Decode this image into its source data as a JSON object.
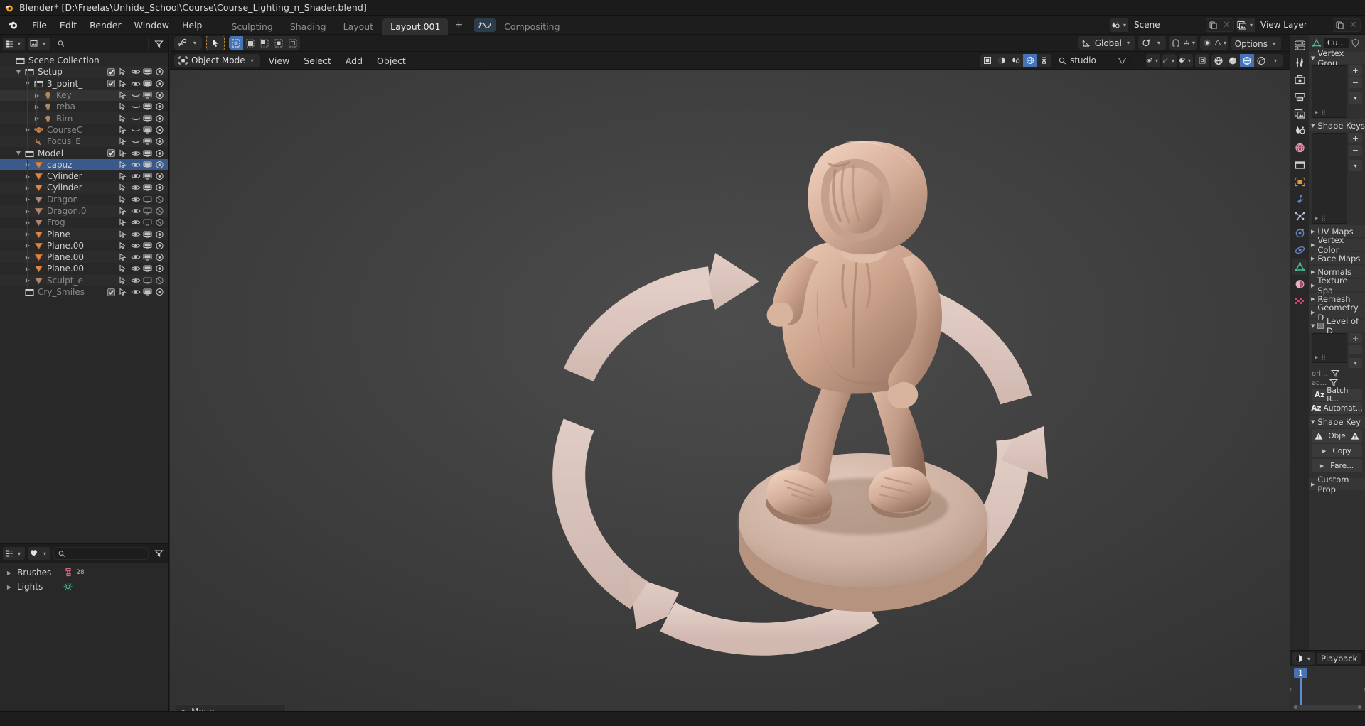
{
  "window": {
    "title": "Blender* [D:\\Freelas\\Unhide_School\\Course\\Course_Lighting_n_Shader.blend]"
  },
  "topbar": {
    "menus": [
      "File",
      "Edit",
      "Render",
      "Window",
      "Help"
    ],
    "workspaces": [
      {
        "label": "Sculpting",
        "active": false
      },
      {
        "label": "Shading",
        "active": false
      },
      {
        "label": "Layout",
        "active": false
      },
      {
        "label": "Layout.001",
        "active": true
      },
      {
        "label": "Compositing",
        "active": false
      }
    ],
    "add_workspace": "+",
    "scene": {
      "label": "Scene",
      "icon": "scene-icon"
    },
    "view_layer": {
      "label": "View Layer",
      "icon": "view-layer-icon"
    }
  },
  "outliner": {
    "header": {
      "display_mode": "view-layer-icon",
      "filter_icon": "filter-icon",
      "search_placeholder": "",
      "search_value": ""
    },
    "rows": [
      {
        "label": "Scene Collection",
        "icon": "collection-icon",
        "depth": 0,
        "disclosure": "",
        "dim": false,
        "checkbox": false,
        "controls": [],
        "selected": false
      },
      {
        "label": "Setup",
        "icon": "collection-icon",
        "depth": 1,
        "disclosure": "down",
        "dim": false,
        "checkbox": true,
        "controls": [
          "cursor",
          "eye",
          "screen",
          "camera"
        ],
        "selected": false
      },
      {
        "label": "3_point_",
        "icon": "collection-icon",
        "depth": 2,
        "disclosure": "down",
        "dim": false,
        "checkbox": true,
        "controls": [
          "cursor",
          "eye",
          "screen",
          "camera"
        ],
        "selected": false
      },
      {
        "label": "Key",
        "icon": "light-icon",
        "depth": 3,
        "disclosure": "right",
        "dim": true,
        "checkbox": false,
        "controls": [
          "cursor",
          "eye-closed",
          "screen",
          "camera"
        ],
        "selected": false,
        "highlight": true
      },
      {
        "label": "reba",
        "icon": "light-icon",
        "depth": 3,
        "disclosure": "right",
        "dim": true,
        "checkbox": false,
        "controls": [
          "cursor",
          "eye-closed",
          "screen",
          "camera"
        ],
        "selected": false
      },
      {
        "label": "Rim",
        "icon": "light-icon",
        "depth": 3,
        "disclosure": "right",
        "dim": true,
        "checkbox": false,
        "controls": [
          "cursor",
          "eye-closed",
          "screen",
          "camera"
        ],
        "selected": false
      },
      {
        "label": "CourseC",
        "icon": "monkey-icon",
        "depth": 2,
        "disclosure": "right",
        "dim": true,
        "checkbox": false,
        "controls": [
          "cursor",
          "eye-closed",
          "screen",
          "camera"
        ],
        "selected": false
      },
      {
        "label": "Focus_E",
        "icon": "empty-icon",
        "depth": 2,
        "disclosure": "",
        "dim": true,
        "checkbox": false,
        "controls": [
          "cursor",
          "eye-closed",
          "screen",
          "camera"
        ],
        "selected": false
      },
      {
        "label": "Model",
        "icon": "collection-icon",
        "depth": 1,
        "disclosure": "down",
        "dim": false,
        "checkbox": true,
        "controls": [
          "cursor",
          "eye",
          "screen",
          "camera"
        ],
        "selected": false
      },
      {
        "label": "capuz",
        "icon": "mesh-icon",
        "depth": 2,
        "disclosure": "right",
        "dim": false,
        "checkbox": false,
        "controls": [
          "cursor",
          "eye",
          "screen",
          "camera"
        ],
        "selected": true
      },
      {
        "label": "Cylinder",
        "icon": "mesh-icon",
        "depth": 2,
        "disclosure": "right",
        "dim": false,
        "checkbox": false,
        "controls": [
          "cursor",
          "eye",
          "screen",
          "camera"
        ],
        "selected": false
      },
      {
        "label": "Cylinder",
        "icon": "mesh-icon",
        "depth": 2,
        "disclosure": "right",
        "dim": false,
        "checkbox": false,
        "controls": [
          "cursor",
          "eye",
          "screen",
          "camera"
        ],
        "selected": false
      },
      {
        "label": "Dragon",
        "icon": "mesh-icon",
        "depth": 2,
        "disclosure": "right",
        "dim": true,
        "checkbox": false,
        "controls": [
          "cursor",
          "eye",
          "screen-off",
          "camera-off"
        ],
        "selected": false
      },
      {
        "label": "Dragon.0",
        "icon": "mesh-icon",
        "depth": 2,
        "disclosure": "right",
        "dim": true,
        "checkbox": false,
        "controls": [
          "cursor",
          "eye",
          "screen-off",
          "camera-off"
        ],
        "selected": false
      },
      {
        "label": "Frog",
        "icon": "mesh-icon",
        "depth": 2,
        "disclosure": "right",
        "dim": true,
        "checkbox": false,
        "controls": [
          "cursor",
          "eye",
          "screen-off",
          "camera-off"
        ],
        "selected": false
      },
      {
        "label": "Plane",
        "icon": "mesh-icon",
        "depth": 2,
        "disclosure": "right",
        "dim": false,
        "checkbox": false,
        "controls": [
          "cursor",
          "eye",
          "screen",
          "camera"
        ],
        "selected": false
      },
      {
        "label": "Plane.00",
        "icon": "mesh-icon",
        "depth": 2,
        "disclosure": "right",
        "dim": false,
        "checkbox": false,
        "controls": [
          "cursor",
          "eye",
          "screen",
          "camera"
        ],
        "selected": false
      },
      {
        "label": "Plane.00",
        "icon": "mesh-icon",
        "depth": 2,
        "disclosure": "right",
        "dim": false,
        "checkbox": false,
        "controls": [
          "cursor",
          "eye",
          "screen",
          "camera"
        ],
        "selected": false
      },
      {
        "label": "Plane.00",
        "icon": "mesh-icon",
        "depth": 2,
        "disclosure": "right",
        "dim": false,
        "checkbox": false,
        "controls": [
          "cursor",
          "eye",
          "screen",
          "camera"
        ],
        "selected": false
      },
      {
        "label": "Sculpt_e",
        "icon": "mesh-icon",
        "depth": 2,
        "disclosure": "right",
        "dim": true,
        "checkbox": false,
        "controls": [
          "cursor",
          "eye",
          "screen-off",
          "camera-off"
        ],
        "selected": false
      },
      {
        "label": "Cry_Smiles",
        "icon": "collection-icon",
        "depth": 1,
        "disclosure": "",
        "dim": true,
        "checkbox": true,
        "controls": [
          "cursor",
          "eye",
          "screen",
          "camera"
        ],
        "selected": false
      }
    ]
  },
  "blender_file_editor": {
    "header": {
      "display_mode": "blender-file-icon",
      "filter_mode": "id-type-icon",
      "search_value": ""
    },
    "rows": [
      {
        "label": "Brushes",
        "icon": "brush-icon",
        "count": "28"
      },
      {
        "label": "Lights",
        "icon": "light-data-icon",
        "count": ""
      }
    ]
  },
  "viewport": {
    "tool_header": {
      "transform_pivot": "transform-pivot-icon",
      "active_tool": "tweak-tool-icon",
      "select_modes": [
        "select-set",
        "select-extend",
        "select-subtract",
        "select-invert",
        "select-intersect"
      ],
      "active_select_mode_index": 0
    },
    "header": {
      "mode": "Object Mode",
      "menus": [
        "View",
        "Select",
        "Add",
        "Object"
      ],
      "transform_orientation": "Global",
      "pivot_point": "pivot-point-icon",
      "snap": "snap-magnet-icon",
      "proportional_edit": "proportional-edit-icon",
      "shading_search": "studio",
      "options_label": "Options",
      "shading_modes": [
        "wireframe",
        "solid",
        "material-preview",
        "rendered"
      ],
      "active_shading_index": 2
    }
  },
  "properties": {
    "tabs": [
      "tool-icon",
      "render-icon",
      "output-icon",
      "view-layer-icon",
      "scene-icon",
      "world-icon",
      "collection-icon",
      "object-icon",
      "modifier-icon",
      "particles-icon",
      "physics-icon",
      "constraints-icon",
      "data-icon",
      "material-icon",
      "texture-icon"
    ],
    "active_tab_index": 12,
    "breadcrumb": {
      "data_icon": "mesh-data-icon",
      "name": "Cu...",
      "shield": "shield-icon"
    },
    "sections": [
      {
        "label": "Vertex Grou",
        "expanded": true
      },
      {
        "label": "Shape Keys",
        "expanded": true
      },
      {
        "label": "UV Maps",
        "expanded": false
      },
      {
        "label": "Vertex Color",
        "expanded": false
      },
      {
        "label": "Face Maps",
        "expanded": false
      },
      {
        "label": "Normals",
        "expanded": false
      },
      {
        "label": "Texture Spa",
        "expanded": false
      },
      {
        "label": "Remesh",
        "expanded": false
      },
      {
        "label": "Geometry D",
        "expanded": false
      },
      {
        "label": "Level of D",
        "expanded": true
      },
      {
        "label": "Shape Key",
        "expanded": true
      },
      {
        "label": "Custom Prop",
        "expanded": false
      }
    ],
    "lod_fields": [
      {
        "label": "ori..."
      },
      {
        "label": "ac..."
      }
    ],
    "buttons": [
      {
        "label": "Batch R...",
        "prefix": "Az"
      },
      {
        "label": "Automat...",
        "prefix": "Az"
      },
      {
        "label": "Obje",
        "prefix": "warn"
      },
      {
        "label": "Copy",
        "prefix": "tri"
      },
      {
        "label": "Pare...",
        "prefix": "tri"
      }
    ]
  },
  "timeline": {
    "editor_type": "timeline-icon",
    "playback_label": "Playback",
    "current_frame": "1"
  },
  "operator_panel": {
    "label": "Move",
    "disclosure": "right"
  },
  "colors": {
    "accent_blue": "#4772b3",
    "selection_row": "#3b5a8c",
    "mesh_orange": "#e08a4a",
    "viewport_bg": "#3d3d3d",
    "panel_bg": "#303030",
    "header_bg": "#1d1d1d"
  }
}
